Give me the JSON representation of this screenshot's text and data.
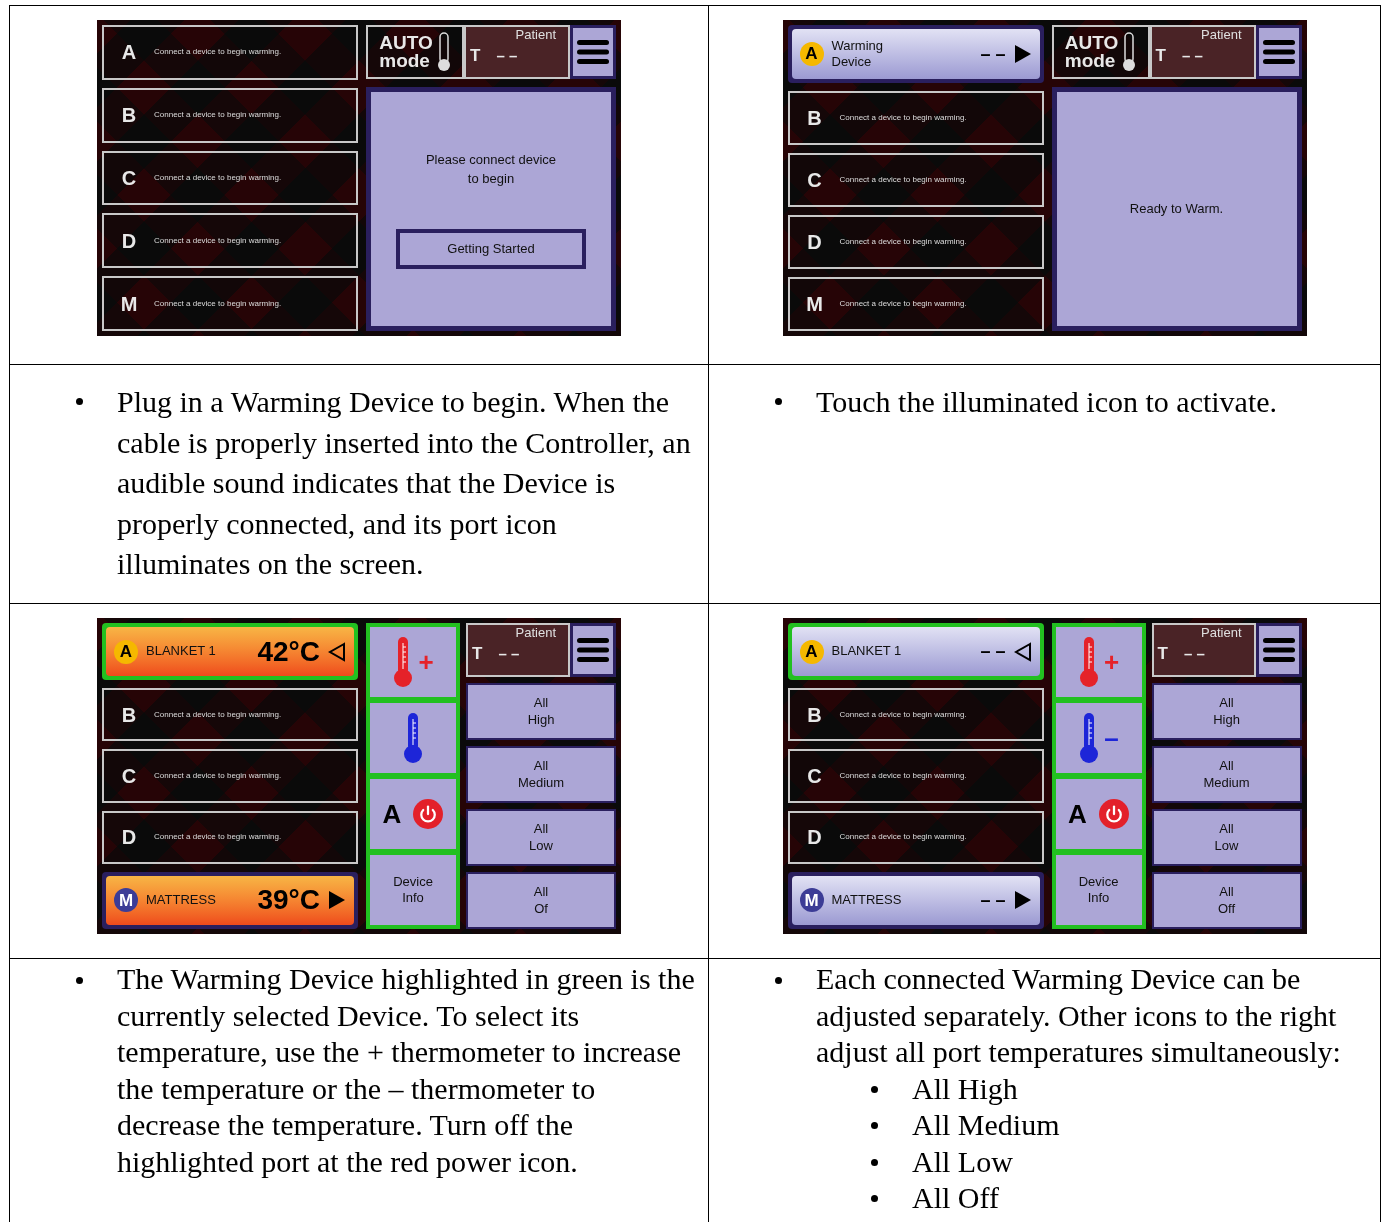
{
  "table": {
    "rows": [
      {
        "cells": [
          {
            "kind": "screen",
            "ports": [
              {
                "kind": "empty",
                "letter": "A",
                "message": "Connect a device to begin warming."
              },
              {
                "kind": "empty",
                "letter": "B",
                "message": "Connect a device to begin warming."
              },
              {
                "kind": "empty",
                "letter": "C",
                "message": "Connect a device to begin warming."
              },
              {
                "kind": "empty",
                "letter": "D",
                "message": "Connect a device to begin warming."
              },
              {
                "kind": "empty",
                "letter": "M",
                "message": "Connect a device to begin warming."
              }
            ],
            "auto_mode": "AUTO mode",
            "patient": {
              "label": "Patient",
              "t": "T",
              "value": "– –"
            },
            "panel": {
              "kind": "message",
              "text": "Please connect device to begin",
              "button": "Getting Started"
            }
          },
          {
            "kind": "screen",
            "ports": [
              {
                "kind": "device",
                "letter": "A",
                "color": "#f5b800",
                "name": "Warming Device",
                "reading": "– –",
                "arrow_filled": true,
                "selected": false,
                "heating": false
              },
              {
                "kind": "empty",
                "letter": "B",
                "message": "Connect a device to begin warming."
              },
              {
                "kind": "empty",
                "letter": "C",
                "message": "Connect a device to begin warming."
              },
              {
                "kind": "empty",
                "letter": "D",
                "message": "Connect a device to begin warming."
              },
              {
                "kind": "empty",
                "letter": "M",
                "message": "Connect a device to begin warming."
              }
            ],
            "auto_mode": "AUTO mode",
            "patient": {
              "label": "Patient",
              "t": "T",
              "value": "– –"
            },
            "panel": {
              "kind": "message",
              "text": "Ready to Warm."
            }
          }
        ]
      },
      {
        "cells": [
          {
            "kind": "text",
            "bullets": [
              {
                "text": "Plug in a Warming Device to begin. When the cable is properly inserted into the Controller, an audible sound indicates that the Device is properly connected, and its port icon illuminates on the screen."
              }
            ]
          },
          {
            "kind": "text",
            "bullets": [
              {
                "text": "Touch the illuminated icon to activate."
              }
            ]
          }
        ]
      },
      {
        "cells": [
          {
            "kind": "screen",
            "ports": [
              {
                "kind": "device",
                "letter": "A",
                "color": "#f5b800",
                "name": "BLANKET 1",
                "reading": "42°C",
                "arrow_filled": false,
                "selected": true,
                "heating": true
              },
              {
                "kind": "empty",
                "letter": "B",
                "message": "Connect a device to begin warming."
              },
              {
                "kind": "empty",
                "letter": "C",
                "message": "Connect a device to begin warming."
              },
              {
                "kind": "empty",
                "letter": "D",
                "message": "Connect a device to begin warming."
              },
              {
                "kind": "device",
                "letter": "M",
                "color": "#3c3c96",
                "name": "MATTRESS",
                "reading": "39°C",
                "arrow_filled": true,
                "selected": false,
                "heating": true
              }
            ],
            "patient": {
              "label": "Patient",
              "t": "T",
              "value": "– –"
            },
            "panel": {
              "kind": "controls",
              "tiles": [
                {
                  "kind": "increase",
                  "sign": "+"
                },
                {
                  "kind": "decrease"
                },
                {
                  "kind": "power",
                  "letter": "A"
                },
                {
                  "kind": "info",
                  "text": "Device Info"
                }
              ],
              "all_buttons": [
                "All High",
                "All Medium",
                "All Low",
                "All Of"
              ]
            }
          },
          {
            "kind": "screen",
            "ports": [
              {
                "kind": "device",
                "letter": "A",
                "color": "#f5b800",
                "name": "BLANKET 1",
                "reading": "– –",
                "arrow_filled": false,
                "selected": true,
                "heating": false
              },
              {
                "kind": "empty",
                "letter": "B",
                "message": "Connect a device to begin warming."
              },
              {
                "kind": "empty",
                "letter": "C",
                "message": "Connect a device to begin warming."
              },
              {
                "kind": "empty",
                "letter": "D",
                "message": "Connect a device to begin warming."
              },
              {
                "kind": "device",
                "letter": "M",
                "color": "#3c3c96",
                "name": "MATTRESS",
                "reading": "– –",
                "arrow_filled": true,
                "selected": false,
                "heating": false
              }
            ],
            "patient": {
              "label": "Patient",
              "t": "T",
              "value": "– –"
            },
            "panel": {
              "kind": "controls",
              "tiles": [
                {
                  "kind": "increase",
                  "sign": "+"
                },
                {
                  "kind": "decrease",
                  "sign": "–"
                },
                {
                  "kind": "power",
                  "letter": "A"
                },
                {
                  "kind": "info",
                  "text": "Device Info"
                }
              ],
              "all_buttons": [
                "All High",
                "All Medium",
                "All Low",
                "All Off"
              ]
            }
          }
        ]
      },
      {
        "cells": [
          {
            "kind": "text",
            "bullets": [
              {
                "text": "The Warming Device highlighted in green is the currently selected Device. To select its temperature, use the + thermometer to increase the temperature or the – thermometer to decrease the temperature. Turn off the highlighted port at the red power icon."
              }
            ]
          },
          {
            "kind": "text",
            "bullets": [
              {
                "text": "Each connected Warming Device can be adjusted separately. Other icons to the right adjust all port temperatures simultaneously:",
                "children": [
                  {
                    "text": "All High"
                  },
                  {
                    "text": "All Medium"
                  },
                  {
                    "text": "All Low"
                  },
                  {
                    "text": "All Off"
                  }
                ]
              }
            ]
          }
        ]
      }
    ]
  }
}
